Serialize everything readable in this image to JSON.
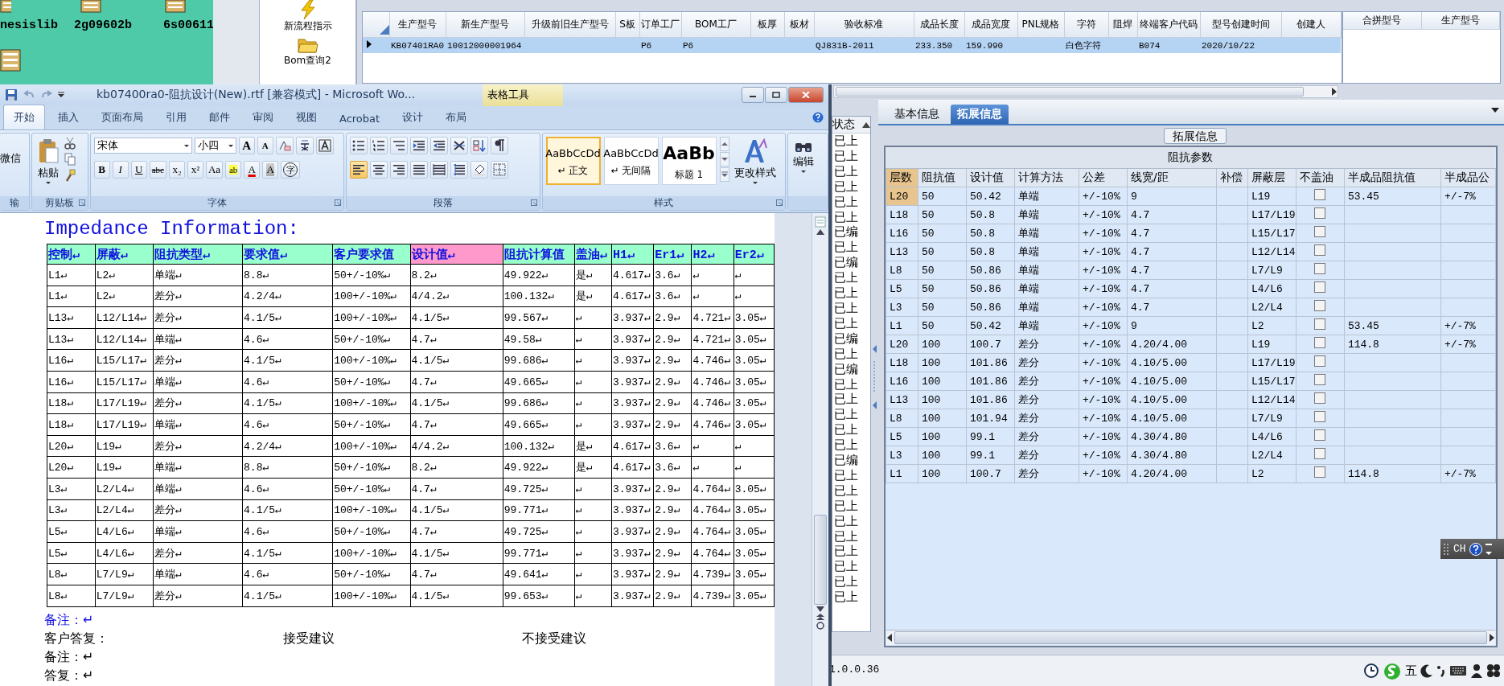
{
  "desktop": {
    "icons": [
      {
        "label": "nesislib"
      },
      {
        "label": "2g09602b"
      },
      {
        "label": "6s00611"
      }
    ]
  },
  "erp": {
    "nav": [
      {
        "kind": "lightning",
        "label": "新流程指示"
      },
      {
        "kind": "folder",
        "label": "Bom查询2"
      }
    ],
    "main_table": {
      "columns": [
        "生产型号",
        "新生产型号",
        "升级前旧生产型号",
        "S板",
        "订单工厂",
        "BOM工厂",
        "板厚",
        "板材",
        "验收标准",
        "成品长度",
        "成品宽度",
        "PNL规格",
        "字符",
        "阻焊",
        "终端客户代码",
        "型号创建时间",
        "创建人"
      ],
      "rows": [
        {
          "selected": true,
          "cells": [
            "KB07401RA0",
            "10012000001964",
            "",
            "",
            "P6",
            "P6",
            "",
            "",
            "QJ831B-2011",
            "233.350",
            "159.990",
            "",
            "白色字符",
            "",
            "B074",
            "2020/10/22",
            ""
          ]
        }
      ]
    },
    "merge_table": {
      "columns": [
        "合拼型号",
        "生产型号"
      ]
    },
    "status_list": {
      "header": "状态",
      "items": [
        "已上",
        "已上",
        "已上",
        "已上",
        "已上",
        "已上",
        "已编",
        "已上",
        "已编",
        "已上",
        "已上",
        "已上",
        "已上",
        "已编",
        "已上",
        "已编",
        "已上",
        "已上",
        "已上",
        "已上",
        "已上",
        "已编",
        "已上",
        "已上",
        "已上",
        "已上",
        "已上",
        "已上",
        "已上",
        "已上",
        "已上"
      ]
    },
    "tabs": [
      {
        "label": "基本信息",
        "selected": false
      },
      {
        "label": "拓展信息",
        "selected": true
      }
    ],
    "ext_group_title": "拓展信息",
    "impedance": {
      "title": "阻抗参数",
      "columns": [
        "层数",
        "阻抗值",
        "设计值",
        "计算方法",
        "公差",
        "线宽/距",
        "补偿",
        "屏蔽层",
        "不盖油",
        "半成品阻抗值",
        "半成品公"
      ],
      "rows": [
        {
          "selected": true,
          "checked": false,
          "cells": [
            "L20",
            "50",
            "50.42",
            "单端",
            "+/-10%",
            "9",
            "",
            "L19",
            "",
            "53.45",
            "+/-7%"
          ]
        },
        {
          "selected": false,
          "checked": false,
          "cells": [
            "L18",
            "50",
            "50.8",
            "单端",
            "+/-10%",
            "4.7",
            "",
            "L17/L19",
            "",
            "",
            ""
          ]
        },
        {
          "selected": false,
          "checked": false,
          "cells": [
            "L16",
            "50",
            "50.8",
            "单端",
            "+/-10%",
            "4.7",
            "",
            "L15/L17",
            "",
            "",
            ""
          ]
        },
        {
          "selected": false,
          "checked": false,
          "cells": [
            "L13",
            "50",
            "50.8",
            "单端",
            "+/-10%",
            "4.7",
            "",
            "L12/L14",
            "",
            "",
            ""
          ]
        },
        {
          "selected": false,
          "checked": false,
          "cells": [
            "L8",
            "50",
            "50.86",
            "单端",
            "+/-10%",
            "4.7",
            "",
            "L7/L9",
            "",
            "",
            ""
          ]
        },
        {
          "selected": false,
          "checked": false,
          "cells": [
            "L5",
            "50",
            "50.86",
            "单端",
            "+/-10%",
            "4.7",
            "",
            "L4/L6",
            "",
            "",
            ""
          ]
        },
        {
          "selected": false,
          "checked": false,
          "cells": [
            "L3",
            "50",
            "50.86",
            "单端",
            "+/-10%",
            "4.7",
            "",
            "L2/L4",
            "",
            "",
            ""
          ]
        },
        {
          "selected": false,
          "checked": false,
          "cells": [
            "L1",
            "50",
            "50.42",
            "单端",
            "+/-10%",
            "9",
            "",
            "L2",
            "",
            "53.45",
            "+/-7%"
          ]
        },
        {
          "selected": false,
          "checked": false,
          "cells": [
            "L20",
            "100",
            "100.7",
            "差分",
            "+/-10%",
            "4.20/4.00",
            "",
            "L19",
            "",
            "114.8",
            "+/-7%"
          ]
        },
        {
          "selected": false,
          "checked": false,
          "cells": [
            "L18",
            "100",
            "101.86",
            "差分",
            "+/-10%",
            "4.10/5.00",
            "",
            "L17/L19",
            "",
            "",
            ""
          ]
        },
        {
          "selected": false,
          "checked": false,
          "cells": [
            "L16",
            "100",
            "101.86",
            "差分",
            "+/-10%",
            "4.10/5.00",
            "",
            "L15/L17",
            "",
            "",
            ""
          ]
        },
        {
          "selected": false,
          "checked": false,
          "cells": [
            "L13",
            "100",
            "101.86",
            "差分",
            "+/-10%",
            "4.10/5.00",
            "",
            "L12/L14",
            "",
            "",
            ""
          ]
        },
        {
          "selected": false,
          "checked": false,
          "cells": [
            "L8",
            "100",
            "101.94",
            "差分",
            "+/-10%",
            "4.10/5.00",
            "",
            "L7/L9",
            "",
            "",
            ""
          ]
        },
        {
          "selected": false,
          "checked": false,
          "cells": [
            "L5",
            "100",
            "99.1",
            "差分",
            "+/-10%",
            "4.30/4.80",
            "",
            "L4/L6",
            "",
            "",
            ""
          ]
        },
        {
          "selected": false,
          "checked": false,
          "cells": [
            "L3",
            "100",
            "99.1",
            "差分",
            "+/-10%",
            "4.30/4.80",
            "",
            "L2/L4",
            "",
            "",
            ""
          ]
        },
        {
          "selected": false,
          "checked": false,
          "cells": [
            "L1",
            "100",
            "100.7",
            "差分",
            "+/-10%",
            "4.20/4.00",
            "",
            "L2",
            "",
            "114.8",
            "+/-7%"
          ]
        }
      ]
    },
    "version": "1.0.0.36"
  },
  "word": {
    "title": "kb07400ra0-阻抗设计(New).rtf [兼容模式] - Microsoft Wo...",
    "context_title": "表格工具",
    "tabs": [
      {
        "label": "开始",
        "selected": true
      },
      {
        "label": "插入",
        "selected": false
      },
      {
        "label": "页面布局",
        "selected": false
      },
      {
        "label": "引用",
        "selected": false
      },
      {
        "label": "邮件",
        "selected": false
      },
      {
        "label": "审阅",
        "selected": false
      },
      {
        "label": "视图",
        "selected": false
      },
      {
        "label": "Acrobat",
        "selected": false
      },
      {
        "label": "设计",
        "selected": false
      },
      {
        "label": "布局",
        "selected": false
      }
    ],
    "ribbon": {
      "transfer": {
        "label": "输",
        "button": "微信"
      },
      "clipboard": {
        "label": "剪贴板",
        "paste": "粘贴"
      },
      "font": {
        "label": "字体",
        "font": "宋体",
        "size": "小四",
        "row1": [
          {
            "kind": "grow",
            "text": "A"
          },
          {
            "kind": "shrink",
            "text": "A"
          }
        ],
        "row2": [
          {
            "kind": "bold",
            "text": "B"
          },
          {
            "kind": "italic",
            "text": "I"
          },
          {
            "kind": "underline",
            "text": "U"
          },
          {
            "kind": "strike",
            "text": "abc"
          },
          {
            "kind": "sub",
            "text": "x₂"
          },
          {
            "kind": "sup",
            "text": "x²"
          },
          {
            "kind": "case",
            "text": "Aa"
          },
          {
            "kind": "highlight",
            "text": "ab"
          },
          {
            "kind": "color",
            "text": "A"
          },
          {
            "kind": "shade",
            "text": "A"
          },
          {
            "kind": "enclose",
            "text": "字"
          }
        ]
      },
      "paragraph": {
        "label": "段落",
        "alignment": [
          {
            "selected": true
          },
          {
            "selected": false
          },
          {
            "selected": false
          },
          {
            "selected": false
          },
          {
            "selected": false
          }
        ]
      },
      "styles": {
        "label": "样式",
        "items": [
          {
            "kind": "body",
            "sample": "AaBbCcDd",
            "name": "↵ 正文",
            "selected": true
          },
          {
            "kind": "body",
            "sample": "AaBbCcDd",
            "name": "↵ 无间隔",
            "selected": false
          },
          {
            "kind": "heading",
            "sample": "AaBb",
            "name": "标题 1",
            "selected": false
          }
        ],
        "change": "更改样式"
      },
      "editing": {
        "button": "编辑"
      }
    },
    "document": {
      "heading": "Impedance Information:",
      "table": {
        "columns": [
          {
            "label": "控制↵",
            "color": "#99ffcc"
          },
          {
            "label": "屏蔽↵",
            "color": "#99ffcc"
          },
          {
            "label": "阻抗类型↵",
            "color": "#99ffcc"
          },
          {
            "label": "要求值↵",
            "color": "#99ffcc"
          },
          {
            "label": "客户要求值",
            "color": "#99ffcc"
          },
          {
            "label": "设计值↵",
            "color": "#ff99cc"
          },
          {
            "label": "阻抗计算值",
            "color": "#99ffcc"
          },
          {
            "label": "盖油↵",
            "color": "#99ffcc"
          },
          {
            "label": "H1↵",
            "color": "#99ffcc"
          },
          {
            "label": "Er1↵",
            "color": "#99ffcc"
          },
          {
            "label": "H2↵",
            "color": "#99ffcc"
          },
          {
            "label": "Er2↵",
            "color": "#99ffcc"
          }
        ],
        "rows": [
          [
            "L1↵",
            "L2↵",
            "单端↵",
            "8.8↵",
            "50+/-10%↵",
            "8.2↵",
            "49.922↵",
            "是↵",
            "4.617↵",
            "3.6↵",
            "↵",
            "↵"
          ],
          [
            "L1↵",
            "L2↵",
            "差分↵",
            "4.2/4↵",
            "100+/-10%↵",
            "4/4.2↵",
            "100.132↵",
            "是↵",
            "4.617↵",
            "3.6↵",
            "↵",
            "↵"
          ],
          [
            "L13↵",
            "L12/L14↵",
            "差分↵",
            "4.1/5↵",
            "100+/-10%↵",
            "4.1/5↵",
            "99.567↵",
            "↵",
            "3.937↵",
            "2.9↵",
            "4.721↵",
            "3.05↵"
          ],
          [
            "L13↵",
            "L12/L14↵",
            "单端↵",
            "4.6↵",
            "50+/-10%↵",
            "4.7↵",
            "49.58↵",
            "↵",
            "3.937↵",
            "2.9↵",
            "4.721↵",
            "3.05↵"
          ],
          [
            "L16↵",
            "L15/L17↵",
            "差分↵",
            "4.1/5↵",
            "100+/-10%↵",
            "4.1/5↵",
            "99.686↵",
            "↵",
            "3.937↵",
            "2.9↵",
            "4.746↵",
            "3.05↵"
          ],
          [
            "L16↵",
            "L15/L17↵",
            "单端↵",
            "4.6↵",
            "50+/-10%↵",
            "4.7↵",
            "49.665↵",
            "↵",
            "3.937↵",
            "2.9↵",
            "4.746↵",
            "3.05↵"
          ],
          [
            "L18↵",
            "L17/L19↵",
            "差分↵",
            "4.1/5↵",
            "100+/-10%↵",
            "4.1/5↵",
            "99.686↵",
            "↵",
            "3.937↵",
            "2.9↵",
            "4.746↵",
            "3.05↵"
          ],
          [
            "L18↵",
            "L17/L19↵",
            "单端↵",
            "4.6↵",
            "50+/-10%↵",
            "4.7↵",
            "49.665↵",
            "↵",
            "3.937↵",
            "2.9↵",
            "4.746↵",
            "3.05↵"
          ],
          [
            "L20↵",
            "L19↵",
            "差分↵",
            "4.2/4↵",
            "100+/-10%↵",
            "4/4.2↵",
            "100.132↵",
            "是↵",
            "4.617↵",
            "3.6↵",
            "↵",
            "↵"
          ],
          [
            "L20↵",
            "L19↵",
            "单端↵",
            "8.8↵",
            "50+/-10%↵",
            "8.2↵",
            "49.922↵",
            "是↵",
            "4.617↵",
            "3.6↵",
            "↵",
            "↵"
          ],
          [
            "L3↵",
            "L2/L4↵",
            "单端↵",
            "4.6↵",
            "50+/-10%↵",
            "4.7↵",
            "49.725↵",
            "↵",
            "3.937↵",
            "2.9↵",
            "4.764↵",
            "3.05↵"
          ],
          [
            "L3↵",
            "L2/L4↵",
            "差分↵",
            "4.1/5↵",
            "100+/-10%↵",
            "4.1/5↵",
            "99.771↵",
            "↵",
            "3.937↵",
            "2.9↵",
            "4.764↵",
            "3.05↵"
          ],
          [
            "L5↵",
            "L4/L6↵",
            "单端↵",
            "4.6↵",
            "50+/-10%↵",
            "4.7↵",
            "49.725↵",
            "↵",
            "3.937↵",
            "2.9↵",
            "4.764↵",
            "3.05↵"
          ],
          [
            "L5↵",
            "L4/L6↵",
            "差分↵",
            "4.1/5↵",
            "100+/-10%↵",
            "4.1/5↵",
            "99.771↵",
            "↵",
            "3.937↵",
            "2.9↵",
            "4.764↵",
            "3.05↵"
          ],
          [
            "L8↵",
            "L7/L9↵",
            "单端↵",
            "4.6↵",
            "50+/-10%↵",
            "4.7↵",
            "49.641↵",
            "↵",
            "3.937↵",
            "2.9↵",
            "4.739↵",
            "3.05↵"
          ],
          [
            "L8↵",
            "L7/L9↵",
            "差分↵",
            "4.1/5↵",
            "100+/-10%↵",
            "4.1/5↵",
            "99.653↵",
            "↵",
            "3.937↵",
            "2.9↵",
            "4.739↵",
            "3.05↵"
          ]
        ]
      },
      "notes": [
        {
          "kind": "remark",
          "text": "备注：↵"
        },
        {
          "kind": "reply",
          "text": "客户答复：",
          "options": [
            "接受建议",
            "不接受建议"
          ]
        },
        {
          "kind": "plain",
          "text": "备注：↵"
        },
        {
          "kind": "plain",
          "text": "答复：↵"
        }
      ]
    }
  },
  "tray": {
    "ime_mode": "五"
  },
  "ime_bar": {
    "label": "CH"
  }
}
